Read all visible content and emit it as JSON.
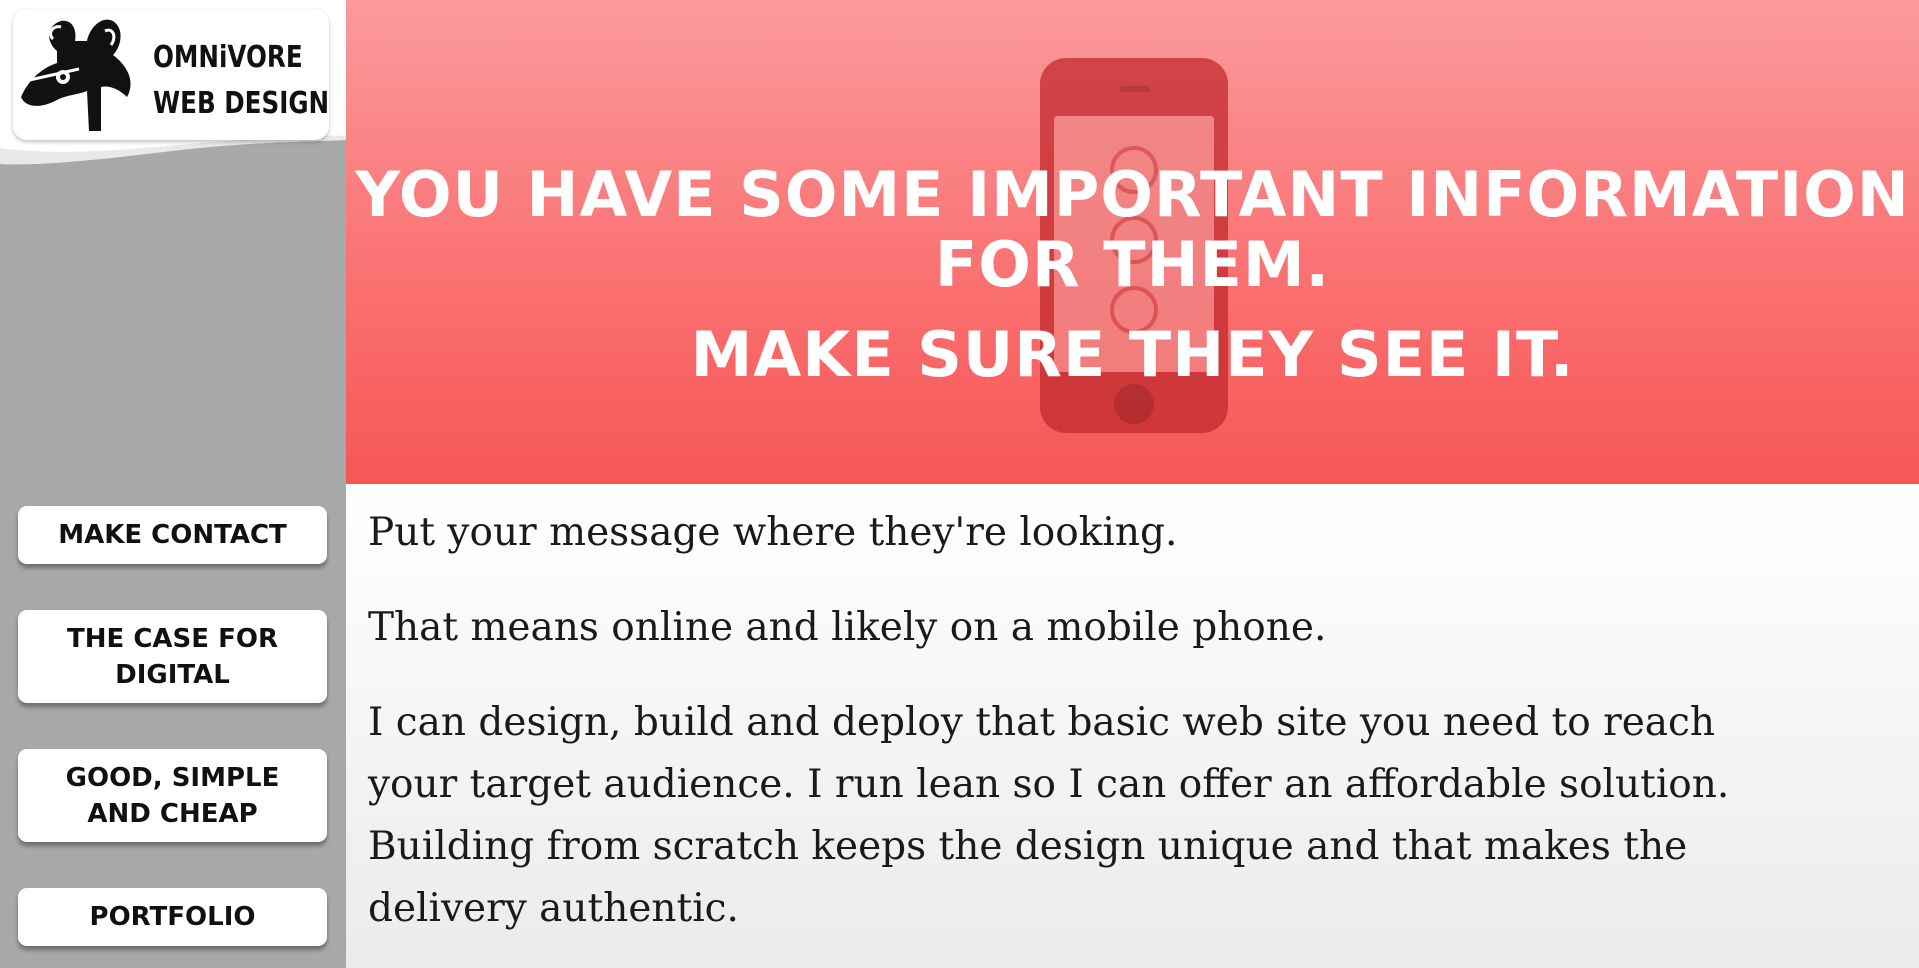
{
  "logo": {
    "line1": "OMNiVORE",
    "line2": "WEB DESIGN",
    "icon": "badger-logo-icon"
  },
  "nav": [
    {
      "lines": [
        "MAKE CONTACT"
      ]
    },
    {
      "lines": [
        "THE CASE FOR",
        "DIGITAL"
      ]
    },
    {
      "lines": [
        "GOOD, SIMPLE",
        "AND CHEAP"
      ]
    },
    {
      "lines": [
        "PORTFOLIO"
      ]
    }
  ],
  "hero": {
    "line1": "YOU HAVE SOME IMPORTANT INFORMATION FOR THEM.",
    "line2": "MAKE SURE THEY SEE IT.",
    "background_icon": "smartphone-icon"
  },
  "content": {
    "p1": "Put your message where they're looking.",
    "p2": "That means online and likely on a mobile phone.",
    "p3": "I can design, build and deploy that basic web site you need to reach your target audience. I run lean so I can offer an affordable solution. Building from scratch keeps the design unique and that makes the delivery authentic."
  },
  "colors": {
    "sidebar": "#a7a8aa",
    "hero_top": "#fb9a9b",
    "hero_bottom": "#f65656",
    "text": "#1a1a1a"
  }
}
